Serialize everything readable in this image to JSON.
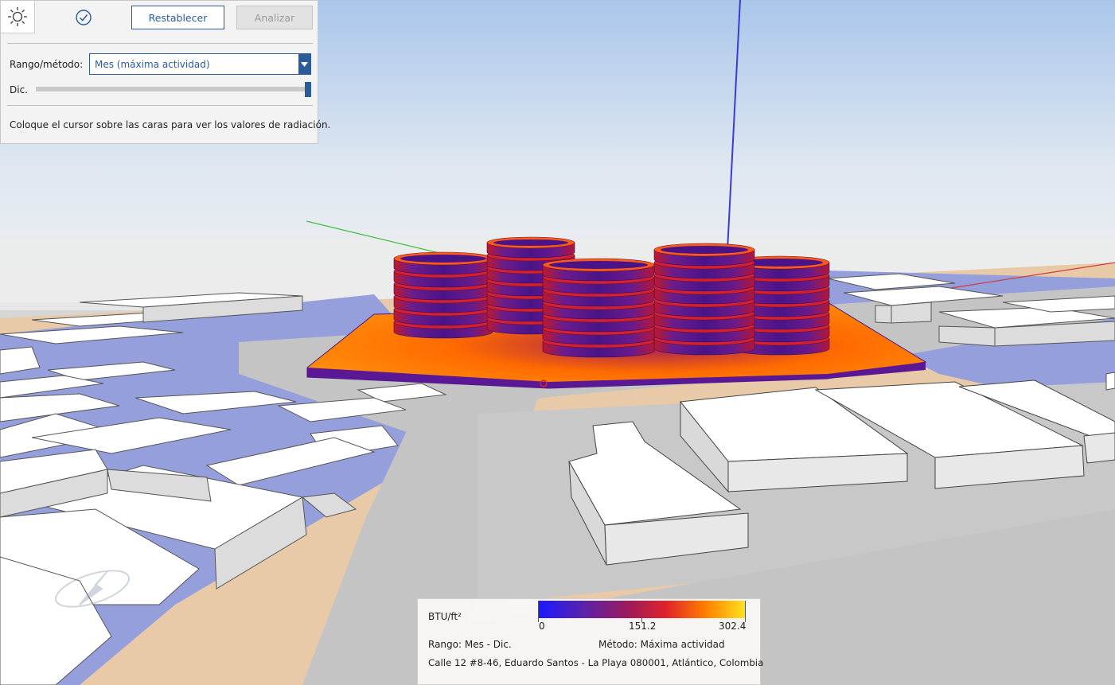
{
  "panel": {
    "sun_icon": "sun-settings-icon",
    "check_icon": "check-circle-icon",
    "reset_label": "Restablecer",
    "analyze_label": "Analizar",
    "range_method_label": "Rango/método:",
    "range_method_value": "Mes (máxima actividad)",
    "month_label": "Dic.",
    "month_slider_value": 1.0,
    "hint": "Coloque el cursor sobre las caras para ver los valores de radiación."
  },
  "legend": {
    "unit": "BTU/ft²",
    "min": "0",
    "mid": "151.2",
    "max": "302.4",
    "range_text": "Rango: Mes - Dic.",
    "method_text": "Método: Máxima actividad",
    "address": "Calle 12 #8-46, Eduardo Santos - La Playa 080001, Atlántico, Colombia"
  },
  "colors": {
    "accent": "#2a5b9a",
    "road": "#c4c4c4",
    "ground": "#e8c9a8",
    "water": "#959fdc",
    "building": "#ffffff",
    "heat_low": "#1a1aff",
    "heat_mid": "#e0242a",
    "heat_high": "#ffe21c"
  }
}
